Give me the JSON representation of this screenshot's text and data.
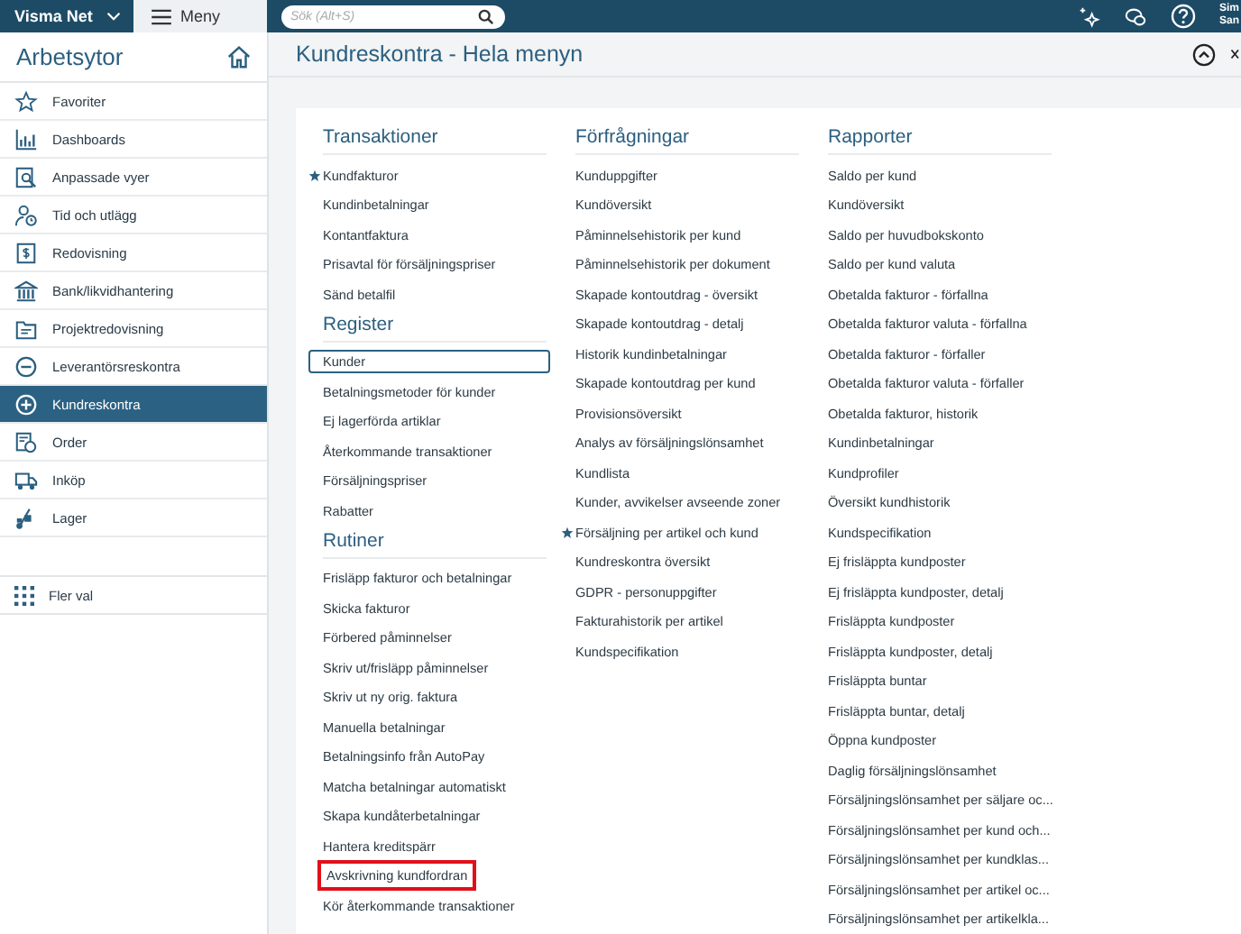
{
  "topbar": {
    "brand": "Visma Net",
    "menu_label": "Meny",
    "search": {
      "placeholder": "Sök (Alt+S)"
    },
    "user": {
      "line_1": "Sim",
      "line_2": "San"
    }
  },
  "sidebar": {
    "title": "Arbetsytor",
    "items": [
      {
        "label": "Favoriter",
        "selected": false
      },
      {
        "label": "Dashboards",
        "selected": false
      },
      {
        "label": "Anpassade vyer",
        "selected": false
      },
      {
        "label": "Tid och utlägg",
        "selected": false
      },
      {
        "label": "Redovisning",
        "selected": false
      },
      {
        "label": "Bank/likvidhantering",
        "selected": false
      },
      {
        "label": "Projektredovisning",
        "selected": false
      },
      {
        "label": "Leverantörsreskontra",
        "selected": false
      },
      {
        "label": "Kundreskontra",
        "selected": true
      },
      {
        "label": "Order",
        "selected": false
      },
      {
        "label": "Inköp",
        "selected": false
      },
      {
        "label": "Lager",
        "selected": false
      }
    ],
    "more": "Fler val"
  },
  "page": {
    "title": "Kundreskontra - Hela menyn",
    "columns": [
      {
        "sections": [
          {
            "heading": "Transaktioner",
            "items": [
              {
                "label": "Kundfakturor",
                "starred": true,
                "focused": false,
                "highlighted": false
              },
              {
                "label": "Kundinbetalningar",
                "starred": false,
                "focused": false,
                "highlighted": false
              },
              {
                "label": "Kontantfaktura",
                "starred": false,
                "focused": false,
                "highlighted": false
              },
              {
                "label": "Prisavtal för försäljningspriser",
                "starred": false,
                "focused": false,
                "highlighted": false
              },
              {
                "label": "Sänd betalfil",
                "starred": false,
                "focused": false,
                "highlighted": false
              }
            ]
          },
          {
            "heading": "Register",
            "items": [
              {
                "label": "Kunder",
                "starred": false,
                "focused": true,
                "highlighted": false
              },
              {
                "label": "Betalningsmetoder för kunder",
                "starred": false,
                "focused": false,
                "highlighted": false
              },
              {
                "label": "Ej lagerförda artiklar",
                "starred": false,
                "focused": false,
                "highlighted": false
              },
              {
                "label": "Återkommande transaktioner",
                "starred": false,
                "focused": false,
                "highlighted": false
              },
              {
                "label": "Försäljningspriser",
                "starred": false,
                "focused": false,
                "highlighted": false
              },
              {
                "label": "Rabatter",
                "starred": false,
                "focused": false,
                "highlighted": false
              }
            ]
          },
          {
            "heading": "Rutiner",
            "items": [
              {
                "label": "Frisläpp fakturor och betalningar",
                "starred": false,
                "focused": false,
                "highlighted": false
              },
              {
                "label": "Skicka fakturor",
                "starred": false,
                "focused": false,
                "highlighted": false
              },
              {
                "label": "Förbered påminnelser",
                "starred": false,
                "focused": false,
                "highlighted": false
              },
              {
                "label": "Skriv ut/frisläpp påminnelser",
                "starred": false,
                "focused": false,
                "highlighted": false
              },
              {
                "label": "Skriv ut ny orig. faktura",
                "starred": false,
                "focused": false,
                "highlighted": false
              },
              {
                "label": "Manuella betalningar",
                "starred": false,
                "focused": false,
                "highlighted": false
              },
              {
                "label": "Betalningsinfo från AutoPay",
                "starred": false,
                "focused": false,
                "highlighted": false
              },
              {
                "label": "Matcha betalningar automatiskt",
                "starred": false,
                "focused": false,
                "highlighted": false
              },
              {
                "label": "Skapa kundåterbetalningar",
                "starred": false,
                "focused": false,
                "highlighted": false
              },
              {
                "label": "Hantera kreditspärr",
                "starred": false,
                "focused": false,
                "highlighted": false
              },
              {
                "label": "Avskrivning kundfordran",
                "starred": false,
                "focused": false,
                "highlighted": true
              },
              {
                "label": "Kör återkommande transaktioner",
                "starred": false,
                "focused": false,
                "highlighted": false
              }
            ]
          }
        ]
      },
      {
        "sections": [
          {
            "heading": "Förfrågningar",
            "items": [
              {
                "label": "Kunduppgifter",
                "starred": false,
                "focused": false,
                "highlighted": false
              },
              {
                "label": "Kundöversikt",
                "starred": false,
                "focused": false,
                "highlighted": false
              },
              {
                "label": "Påminnelsehistorik per kund",
                "starred": false,
                "focused": false,
                "highlighted": false
              },
              {
                "label": "Påminnelsehistorik per dokument",
                "starred": false,
                "focused": false,
                "highlighted": false
              },
              {
                "label": "Skapade kontoutdrag - översikt",
                "starred": false,
                "focused": false,
                "highlighted": false
              },
              {
                "label": "Skapade kontoutdrag - detalj",
                "starred": false,
                "focused": false,
                "highlighted": false
              },
              {
                "label": "Historik kundinbetalningar",
                "starred": false,
                "focused": false,
                "highlighted": false
              },
              {
                "label": "Skapade kontoutdrag per kund",
                "starred": false,
                "focused": false,
                "highlighted": false
              },
              {
                "label": "Provisionsöversikt",
                "starred": false,
                "focused": false,
                "highlighted": false
              },
              {
                "label": "Analys av försäljningslönsamhet",
                "starred": false,
                "focused": false,
                "highlighted": false
              },
              {
                "label": "Kundlista",
                "starred": false,
                "focused": false,
                "highlighted": false
              },
              {
                "label": "Kunder, avvikelser avseende zoner",
                "starred": false,
                "focused": false,
                "highlighted": false
              },
              {
                "label": "Försäljning per artikel och kund",
                "starred": true,
                "focused": false,
                "highlighted": false
              },
              {
                "label": "Kundreskontra översikt",
                "starred": false,
                "focused": false,
                "highlighted": false
              },
              {
                "label": "GDPR - personuppgifter",
                "starred": false,
                "focused": false,
                "highlighted": false
              },
              {
                "label": "Fakturahistorik per artikel",
                "starred": false,
                "focused": false,
                "highlighted": false
              },
              {
                "label": "Kundspecifikation",
                "starred": false,
                "focused": false,
                "highlighted": false
              }
            ]
          }
        ]
      },
      {
        "sections": [
          {
            "heading": "Rapporter",
            "items": [
              {
                "label": "Saldo per kund",
                "starred": false,
                "focused": false,
                "highlighted": false
              },
              {
                "label": "Kundöversikt",
                "starred": false,
                "focused": false,
                "highlighted": false
              },
              {
                "label": "Saldo per huvudbokskonto",
                "starred": false,
                "focused": false,
                "highlighted": false
              },
              {
                "label": "Saldo per kund valuta",
                "starred": false,
                "focused": false,
                "highlighted": false
              },
              {
                "label": "Obetalda fakturor - förfallna",
                "starred": false,
                "focused": false,
                "highlighted": false
              },
              {
                "label": "Obetalda fakturor valuta - förfallna",
                "starred": false,
                "focused": false,
                "highlighted": false
              },
              {
                "label": "Obetalda fakturor - förfaller",
                "starred": false,
                "focused": false,
                "highlighted": false
              },
              {
                "label": "Obetalda fakturor valuta - förfaller",
                "starred": false,
                "focused": false,
                "highlighted": false
              },
              {
                "label": "Obetalda fakturor, historik",
                "starred": false,
                "focused": false,
                "highlighted": false
              },
              {
                "label": "Kundinbetalningar",
                "starred": false,
                "focused": false,
                "highlighted": false
              },
              {
                "label": "Kundprofiler",
                "starred": false,
                "focused": false,
                "highlighted": false
              },
              {
                "label": "Översikt kundhistorik",
                "starred": false,
                "focused": false,
                "highlighted": false
              },
              {
                "label": "Kundspecifikation",
                "starred": false,
                "focused": false,
                "highlighted": false
              },
              {
                "label": "Ej frisläppta kundposter",
                "starred": false,
                "focused": false,
                "highlighted": false
              },
              {
                "label": "Ej frisläppta kundposter, detalj",
                "starred": false,
                "focused": false,
                "highlighted": false
              },
              {
                "label": "Frisläppta kundposter",
                "starred": false,
                "focused": false,
                "highlighted": false
              },
              {
                "label": "Frisläppta kundposter, detalj",
                "starred": false,
                "focused": false,
                "highlighted": false
              },
              {
                "label": "Frisläppta buntar",
                "starred": false,
                "focused": false,
                "highlighted": false
              },
              {
                "label": "Frisläppta buntar, detalj",
                "starred": false,
                "focused": false,
                "highlighted": false
              },
              {
                "label": "Öppna kundposter",
                "starred": false,
                "focused": false,
                "highlighted": false
              },
              {
                "label": "Daglig försäljningslönsamhet",
                "starred": false,
                "focused": false,
                "highlighted": false
              },
              {
                "label": "Försäljningslönsamhet per säljare oc...",
                "starred": false,
                "focused": false,
                "highlighted": false
              },
              {
                "label": "Försäljningslönsamhet per kund och...",
                "starred": false,
                "focused": false,
                "highlighted": false
              },
              {
                "label": "Försäljningslönsamhet per kundklas...",
                "starred": false,
                "focused": false,
                "highlighted": false
              },
              {
                "label": "Försäljningslönsamhet per artikel oc...",
                "starred": false,
                "focused": false,
                "highlighted": false
              },
              {
                "label": "Försäljningslönsamhet per artikelkla...",
                "starred": false,
                "focused": false,
                "highlighted": false
              }
            ]
          }
        ]
      }
    ]
  }
}
